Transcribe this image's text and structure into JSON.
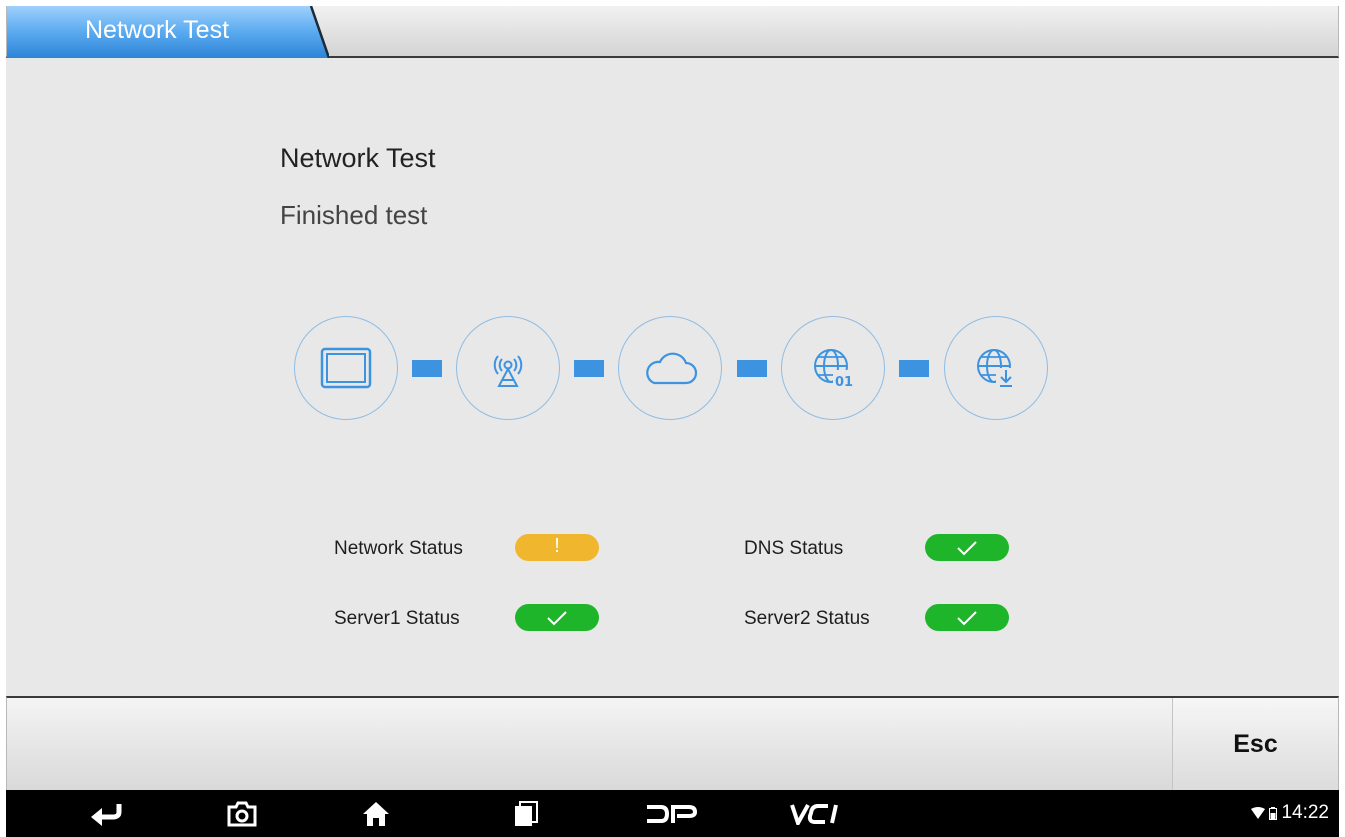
{
  "header": {
    "tab_title": "Network Test"
  },
  "main": {
    "title": "Network Test",
    "subtitle": "Finished test",
    "chain_icons": [
      "tablet-icon",
      "signal-tower-icon",
      "cloud-icon",
      "globe-data-icon",
      "globe-download-icon"
    ],
    "statuses": {
      "network": {
        "label": "Network Status",
        "state": "warning"
      },
      "dns": {
        "label": "DNS Status",
        "state": "ok"
      },
      "server1": {
        "label": "Server1 Status",
        "state": "ok"
      },
      "server2": {
        "label": "Server2 Status",
        "state": "ok"
      }
    },
    "warning_symbol": "!"
  },
  "footer": {
    "esc_label": "Esc"
  },
  "navbar": {
    "buttons": [
      "back-icon",
      "camera-icon",
      "home-icon",
      "recent-apps-icon",
      "dp-icon",
      "vci-icon"
    ],
    "time": "14:22"
  },
  "colors": {
    "accent": "#3d93e0",
    "warning": "#f0b72e",
    "ok": "#1fb52b"
  }
}
